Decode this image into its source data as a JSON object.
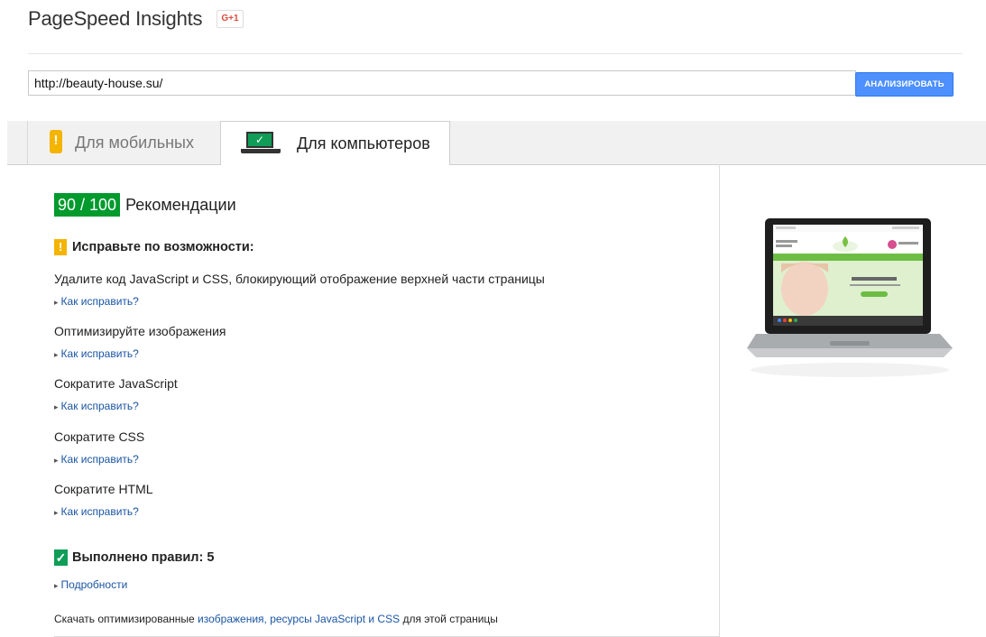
{
  "header": {
    "title": "PageSpeed Insights",
    "gplus_label": "G+1"
  },
  "search": {
    "url_value": "http://beauty-house.su/",
    "analyze_label": "АНАЛИЗИРОВАТЬ"
  },
  "tabs": [
    {
      "label": "Для мобильных",
      "active": false
    },
    {
      "label": "Для компьютеров",
      "active": true
    }
  ],
  "score": {
    "value": "90 / 100",
    "label": "Рекомендации",
    "color": "#009a2d"
  },
  "consider_fixing": {
    "heading": "Исправьте по возможности:",
    "rules": [
      {
        "title": "Удалите код JavaScript и CSS, блокирующий отображение верхней части страницы",
        "link": "Как исправить?"
      },
      {
        "title": "Оптимизируйте изображения",
        "link": "Как исправить?"
      },
      {
        "title": "Сократите JavaScript",
        "link": "Как исправить?"
      },
      {
        "title": "Сократите CSS",
        "link": "Как исправить?"
      },
      {
        "title": "Сократите HTML",
        "link": "Как исправить?"
      }
    ]
  },
  "passed": {
    "heading": "Выполнено правил: 5",
    "link": "Подробности"
  },
  "footer": {
    "prefix": "Скачать оптимизированные",
    "link_text": "изображения, ресурсы JavaScript и CSS",
    "suffix": "для этой страницы"
  },
  "colors": {
    "warning": "#f4b400",
    "pass": "#0f9d58",
    "link": "#1a55a5",
    "button": "#4d90fe"
  },
  "icons": [
    "gplus-icon",
    "mobile-phone-icon",
    "laptop-icon",
    "warning-icon",
    "checkmark-icon",
    "expand-arrow-icon"
  ]
}
